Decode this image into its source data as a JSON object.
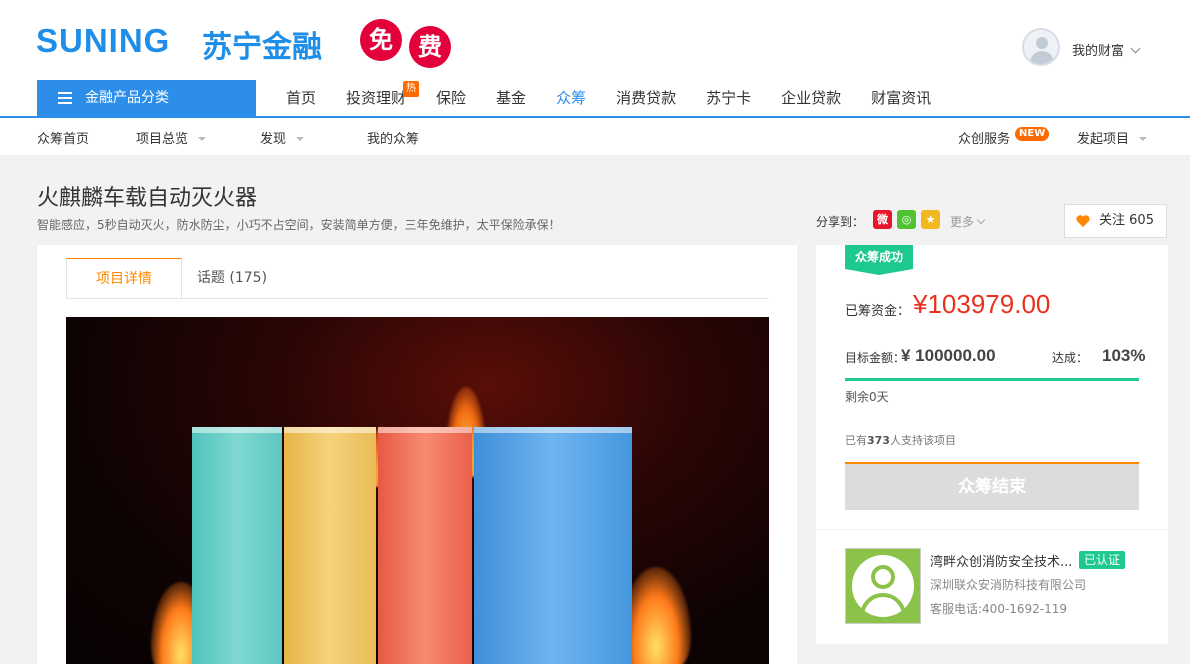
{
  "header": {
    "logo_en": "SUNING",
    "logo_cn": "苏宁金融",
    "free_1": "免",
    "free_2": "费",
    "user_menu": "我的财富",
    "category_button": "金融产品分类",
    "nav": [
      {
        "label": "首页"
      },
      {
        "label": "投资理财",
        "badge": "热"
      },
      {
        "label": "保险"
      },
      {
        "label": "基金"
      },
      {
        "label": "众筹",
        "active": true
      },
      {
        "label": "消费贷款"
      },
      {
        "label": "苏宁卡"
      },
      {
        "label": "企业贷款"
      },
      {
        "label": "财富资讯"
      }
    ]
  },
  "subnav": {
    "home": "众筹首页",
    "overview": "项目总览",
    "discover": "发现",
    "my": "我的众筹",
    "service": "众创服务",
    "service_badge": "NEW",
    "launch": "发起项目"
  },
  "project": {
    "title": "火麒麟车载自动灭火器",
    "subtitle": "智能感应，5秒自动灭火，防水防尘，小巧不占空间，安装简单方便，三年免维护，太平保险承保！",
    "share_label": "分享到：",
    "share_more": "更多",
    "follow_label": "关注",
    "follow_count": "605",
    "tabs": {
      "detail": "项目详情",
      "topic": "话题",
      "topic_count": "(175)"
    }
  },
  "funding": {
    "status_tag": "众筹成功",
    "raised_label": "已筹资金：",
    "raised_value": "¥103979.00",
    "target_label": "目标金额：",
    "target_value": "¥ 100000.00",
    "reach_label": "达成：",
    "reach_value": "103%",
    "progress_fraction": 1.0,
    "remain": "剩余0天",
    "supporters_prefix": "已有",
    "supporters_count": "373",
    "supporters_suffix": "人支持该项目",
    "end_button": "众筹结束"
  },
  "company": {
    "name": "湾畔众创消防安全技术...",
    "verified": "已认证",
    "full_name": "深圳联众安消防科技有限公司",
    "phone": "客服电话:400-1692-119"
  },
  "colors": {
    "brand_blue": "#2c8ee9",
    "accent_orange": "#ff8800",
    "price_red": "#e8321e",
    "success_green": "#1ec98f"
  }
}
